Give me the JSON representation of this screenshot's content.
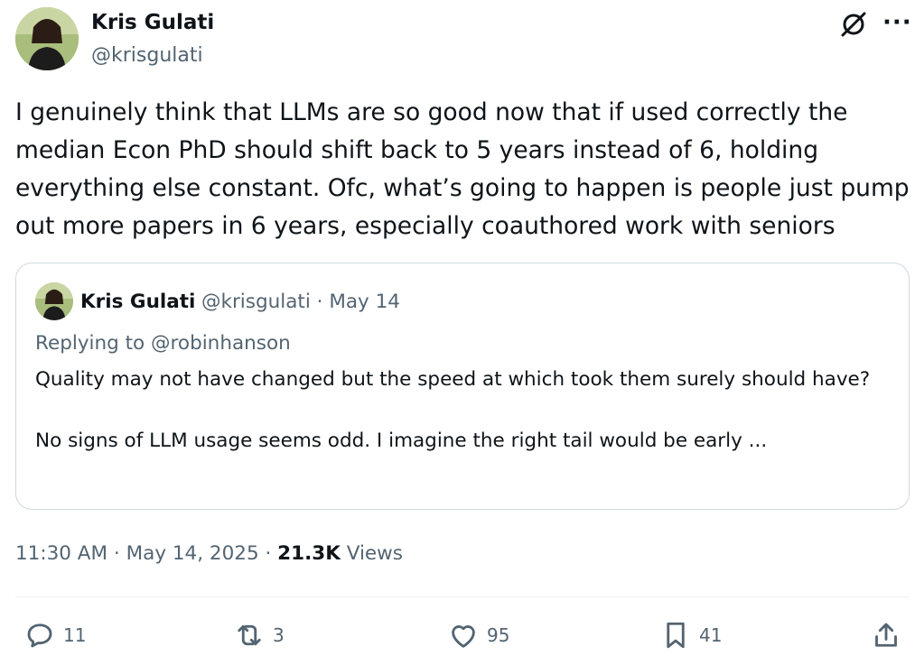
{
  "author": {
    "display_name": "Kris Gulati",
    "handle": "@krisgulati",
    "avatar_icon": "profile-photo-icon"
  },
  "header_icons": {
    "grok": "grok-icon",
    "more": "···"
  },
  "tweet": {
    "text": "I genuinely think that LLMs are so good now that if used correctly the median Econ PhD should shift back to 5 years instead of 6, holding everything else constant. Ofc, what’s going to happen is people just pump out more papers in 6 years, especially coauthored work with seniors"
  },
  "quoted_tweet": {
    "display_name": "Kris Gulati",
    "handle": "@krisgulati",
    "separator": "·",
    "date": "May 14",
    "replying_to": "Replying to @robinhanson",
    "text": "Quality may not have changed but the speed at which took them surely should have?\n\nNo signs of LLM usage seems odd. I imagine the right tail would be early ..."
  },
  "meta": {
    "time": "11:30 AM",
    "sep1": "·",
    "date": "May 14, 2025",
    "sep2": "·",
    "views_count": "21.3K",
    "views_label": "Views"
  },
  "actions": {
    "replies": "11",
    "reposts": "3",
    "likes": "95",
    "bookmarks": "41"
  },
  "colors": {
    "text": "#0f1419",
    "secondary": "#536471",
    "border": "#cfd9de"
  }
}
